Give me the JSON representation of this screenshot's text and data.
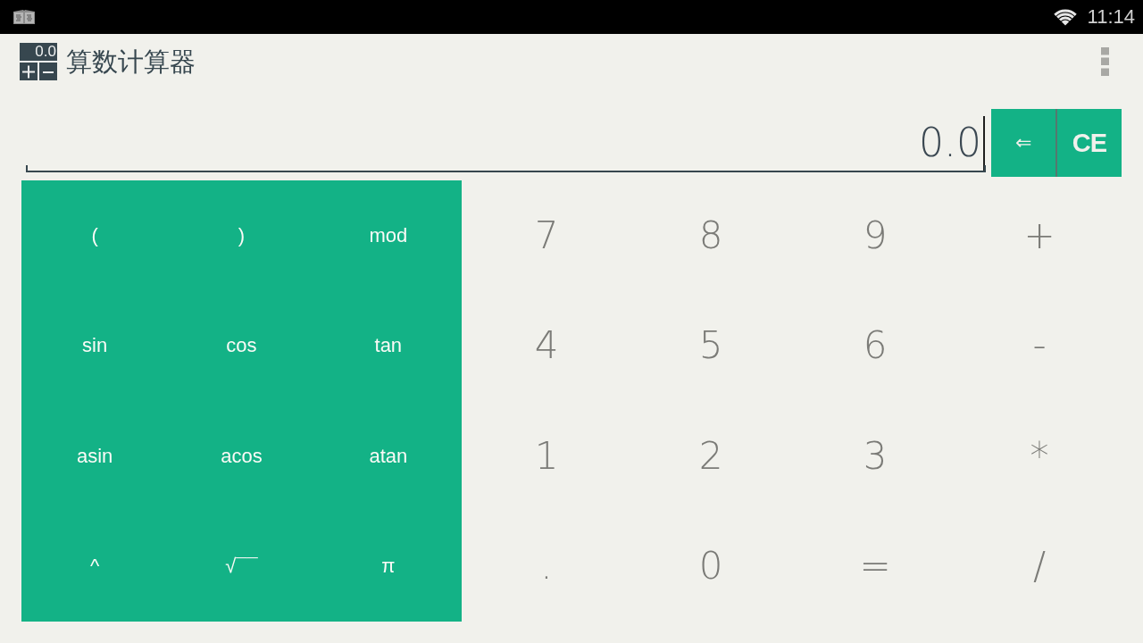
{
  "status_bar": {
    "time": "11:14"
  },
  "action_bar": {
    "logo_display": "0.0",
    "title": "算数计算器"
  },
  "display": {
    "value": "0.0"
  },
  "edit_buttons": [
    {
      "label": "⇐",
      "kind": "backspace"
    },
    {
      "label": "CE",
      "kind": "clear"
    }
  ],
  "function_keys": [
    "(",
    ")",
    "mod",
    "sin",
    "cos",
    "tan",
    "asin",
    "acos",
    "atan",
    "^",
    "√¯¯",
    "π"
  ],
  "number_keys": [
    "7",
    "8",
    "9",
    "+",
    "4",
    "5",
    "6",
    "-",
    "1",
    "2",
    "3",
    "*",
    ".",
    "0",
    "=",
    "/"
  ]
}
